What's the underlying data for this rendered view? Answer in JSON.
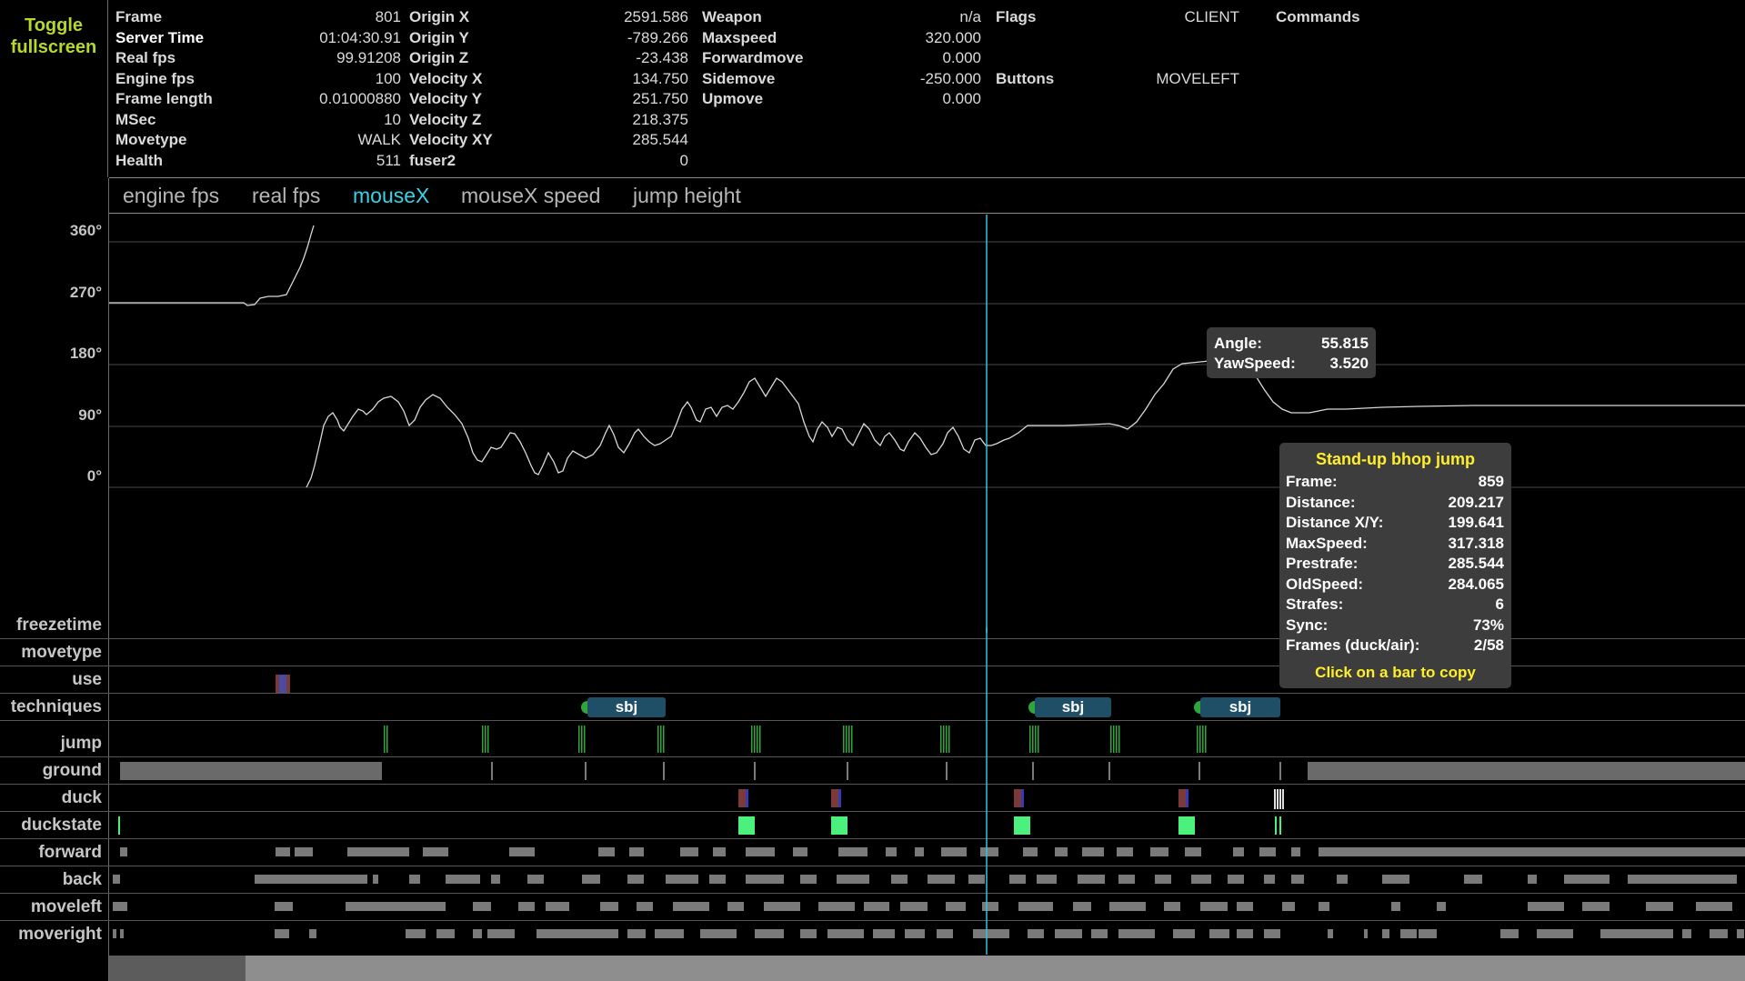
{
  "toggle": {
    "label": "Toggle\nfullscreen"
  },
  "info": {
    "col1": [
      {
        "k": "Frame",
        "v": "801"
      },
      {
        "k": "Server Time",
        "v": "01:04:30.91"
      },
      {
        "k": "Real fps",
        "v": "99.91208"
      },
      {
        "k": "Engine fps",
        "v": "100"
      },
      {
        "k": "Frame length",
        "v": "0.01000880"
      },
      {
        "k": "MSec",
        "v": "10"
      },
      {
        "k": "Movetype",
        "v": "WALK"
      },
      {
        "k": "Health",
        "v": "511"
      }
    ],
    "col2": [
      {
        "k": "Origin X",
        "v": "2591.586"
      },
      {
        "k": "Origin Y",
        "v": "-789.266"
      },
      {
        "k": "Origin Z",
        "v": "-23.438"
      },
      {
        "k": "Velocity X",
        "v": "134.750"
      },
      {
        "k": "Velocity Y",
        "v": "251.750"
      },
      {
        "k": "Velocity Z",
        "v": "218.375"
      },
      {
        "k": "Velocity XY",
        "v": "285.544"
      },
      {
        "k": "fuser2",
        "v": "0"
      }
    ],
    "col3": [
      {
        "k": "Weapon",
        "v": "n/a"
      },
      {
        "k": "Maxspeed",
        "v": "320.000"
      },
      {
        "k": "Forwardmove",
        "v": "0.000"
      },
      {
        "k": "Sidemove",
        "v": "-250.000"
      },
      {
        "k": "Upmove",
        "v": "0.000"
      }
    ],
    "flags": {
      "k": "Flags",
      "v": "CLIENT"
    },
    "buttons": {
      "k": "Buttons",
      "v": "MOVELEFT"
    },
    "commands": {
      "k": "Commands"
    }
  },
  "tabs": [
    "engine fps",
    "real fps",
    "mouseX",
    "mouseX speed",
    "jump height"
  ],
  "active_tab": "mouseX",
  "graph": {
    "y_ticks": [
      "360°",
      "270°",
      "180°",
      "90°",
      "0°"
    ]
  },
  "rows": [
    "freezetime",
    "movetype",
    "use",
    "techniques",
    "jump",
    "ground",
    "duck",
    "duckstate",
    "forward",
    "back",
    "moveleft",
    "moveright"
  ],
  "techniques": {
    "label": "sbj"
  },
  "angle_tooltip": {
    "angle_label": "Angle:",
    "angle_value": "55.815",
    "yaw_label": "YawSpeed:",
    "yaw_value": "3.520"
  },
  "jump_tooltip": {
    "title": "Stand-up bhop jump",
    "fields": [
      {
        "k": "Frame:",
        "v": "859"
      },
      {
        "k": "Distance:",
        "v": "209.217"
      },
      {
        "k": "Distance X/Y:",
        "v": "199.641"
      },
      {
        "k": "MaxSpeed:",
        "v": "317.318"
      },
      {
        "k": "Prestrafe:",
        "v": "285.544"
      },
      {
        "k": "OldSpeed:",
        "v": "284.065"
      },
      {
        "k": "Strafes:",
        "v": "6"
      },
      {
        "k": "Sync:",
        "v": "73%"
      },
      {
        "k": "Frames (duck/air):",
        "v": "2/58"
      }
    ],
    "footer": "Click on a bar to copy"
  },
  "colors": {
    "toggle": "#b5d82a",
    "active_tab": "#38d3e6",
    "cursor": "#34c3da",
    "tooltip_title": "#ffef2a",
    "sbj": "#1e4f67",
    "jump": "#2fa63a",
    "duckstate": "#4cf07c"
  }
}
